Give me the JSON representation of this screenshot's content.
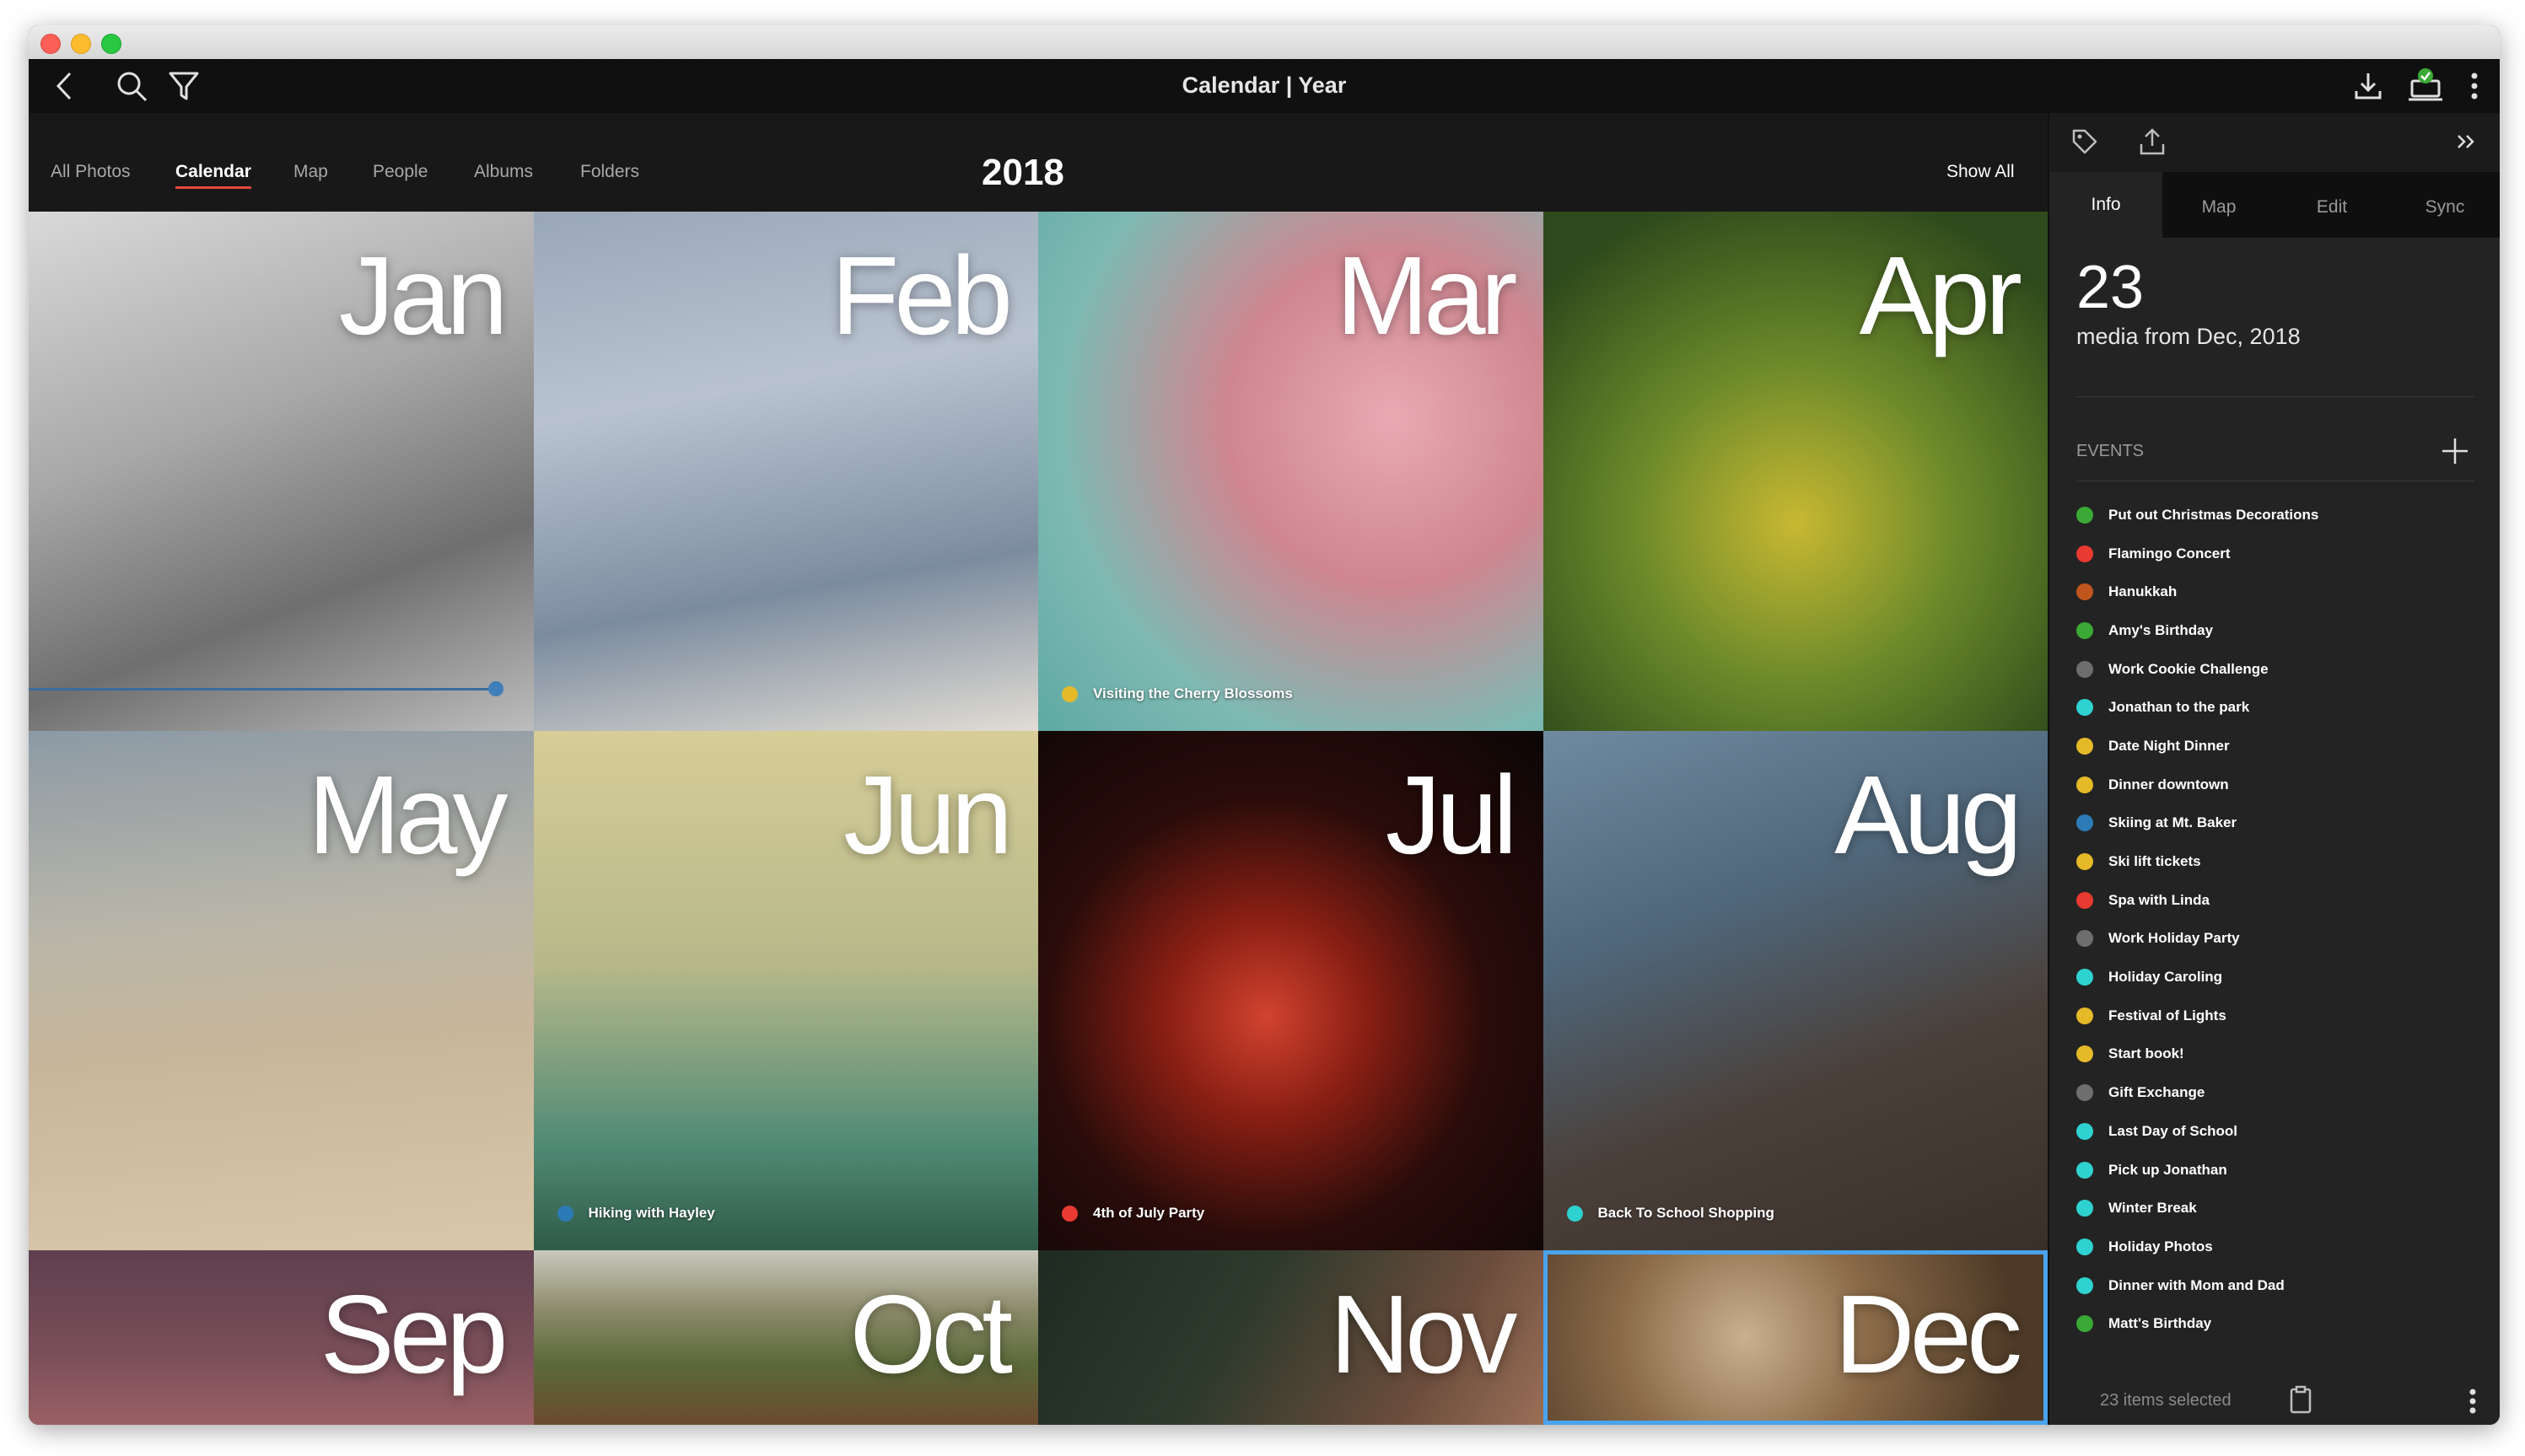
{
  "window": {
    "title": "Calendar | Year"
  },
  "nav": {
    "tabs": [
      {
        "label": "All Photos"
      },
      {
        "label": "Calendar"
      },
      {
        "label": "Map"
      },
      {
        "label": "People"
      },
      {
        "label": "Albums"
      },
      {
        "label": "Folders"
      }
    ],
    "active_tab": "Calendar",
    "year": "2018",
    "show_all": "Show All"
  },
  "months": [
    {
      "label": "Jan",
      "event": "",
      "event_color": ""
    },
    {
      "label": "Feb",
      "event": "",
      "event_color": ""
    },
    {
      "label": "Mar",
      "event": "Visiting the Cherry Blossoms",
      "event_color": "#e5b928"
    },
    {
      "label": "Apr",
      "event": "",
      "event_color": ""
    },
    {
      "label": "May",
      "event": "",
      "event_color": ""
    },
    {
      "label": "Jun",
      "event": "Hiking with Hayley",
      "event_color": "#2c7bb6"
    },
    {
      "label": "Jul",
      "event": "4th of July Party",
      "event_color": "#e83a30"
    },
    {
      "label": "Aug",
      "event": "Back To School Shopping",
      "event_color": "#2ed3d1"
    },
    {
      "label": "Sep",
      "event": "",
      "event_color": ""
    },
    {
      "label": "Oct",
      "event": "",
      "event_color": ""
    },
    {
      "label": "Nov",
      "event": "",
      "event_color": ""
    },
    {
      "label": "Dec",
      "event": "",
      "event_color": ""
    }
  ],
  "selected_month": "Dec",
  "panel": {
    "tabs": [
      {
        "label": "Info"
      },
      {
        "label": "Map"
      },
      {
        "label": "Edit"
      },
      {
        "label": "Sync"
      }
    ],
    "active_tab": "Info",
    "count": "23",
    "media_from": "media from Dec, 2018",
    "events_heading": "EVENTS",
    "events": [
      {
        "label": "Put out Christmas Decorations",
        "color": "#3aa935"
      },
      {
        "label": "Flamingo Concert",
        "color": "#e83a30"
      },
      {
        "label": "Hanukkah",
        "color": "#c0561e"
      },
      {
        "label": "Amy's Birthday",
        "color": "#3aa935"
      },
      {
        "label": "Work Cookie Challenge",
        "color": "#6e6e6e"
      },
      {
        "label": "Jonathan to the park",
        "color": "#2ed3d1"
      },
      {
        "label": "Date Night Dinner",
        "color": "#e5b928"
      },
      {
        "label": "Dinner downtown",
        "color": "#e5b928"
      },
      {
        "label": "Skiing at Mt. Baker",
        "color": "#2c7bb6"
      },
      {
        "label": "Ski lift tickets",
        "color": "#e5b928"
      },
      {
        "label": "Spa with Linda",
        "color": "#e83a30"
      },
      {
        "label": "Work Holiday Party",
        "color": "#6e6e6e"
      },
      {
        "label": "Holiday Caroling",
        "color": "#2ed3d1"
      },
      {
        "label": "Festival of Lights",
        "color": "#e5b928"
      },
      {
        "label": "Start book!",
        "color": "#e5b928"
      },
      {
        "label": "Gift Exchange",
        "color": "#6e6e6e"
      },
      {
        "label": "Last Day of School",
        "color": "#2ed3d1"
      },
      {
        "label": "Pick up Jonathan",
        "color": "#2ed3d1"
      },
      {
        "label": "Winter Break",
        "color": "#2ed3d1"
      },
      {
        "label": "Holiday Photos",
        "color": "#2ed3d1"
      },
      {
        "label": "Dinner with Mom and Dad",
        "color": "#2ed3d1"
      },
      {
        "label": "Matt's Birthday",
        "color": "#3aa935"
      }
    ],
    "footer": "23 items selected"
  },
  "icons": {
    "back": "back-chevron-icon",
    "search": "search-icon",
    "filter": "filter-icon",
    "download": "download-icon",
    "sync_status": "sync-status-icon",
    "more": "more-vertical-icon",
    "tag": "tag-icon",
    "share": "share-icon",
    "collapse": "collapse-panel-icon",
    "add": "plus-icon",
    "clipboard": "clipboard-icon"
  }
}
